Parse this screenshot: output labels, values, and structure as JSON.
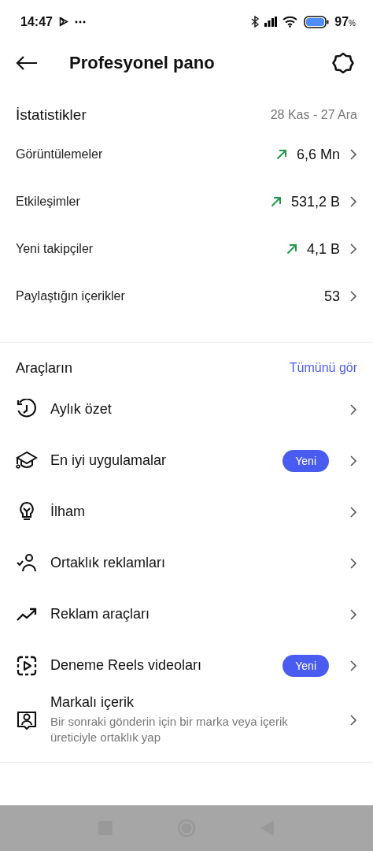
{
  "status_bar": {
    "time": "14:47",
    "battery_percent": "97",
    "percent_sign": "%"
  },
  "header": {
    "title": "Profesyonel pano"
  },
  "statistics": {
    "title": "İstatistikler",
    "date_range": "28 Kas - 27 Ara",
    "rows": [
      {
        "label": "Görüntülemeler",
        "value": "6,6 Mn",
        "trending_up": true
      },
      {
        "label": "Etkileşimler",
        "value": "531,2 B",
        "trending_up": true
      },
      {
        "label": "Yeni takipçiler",
        "value": "4,1 B",
        "trending_up": true
      },
      {
        "label": "Paylaştığın içerikler",
        "value": "53",
        "trending_up": false
      }
    ]
  },
  "tools": {
    "title": "Araçların",
    "see_all": "Tümünü gör",
    "items": [
      {
        "kind": "clock",
        "label": "Aylık özet"
      },
      {
        "kind": "cap",
        "label": "En iyi uygulamalar",
        "badge": "Yeni"
      },
      {
        "kind": "bulb",
        "label": "İlham"
      },
      {
        "kind": "partner",
        "label": "Ortaklık reklamları"
      },
      {
        "kind": "trend",
        "label": "Reklam araçları"
      },
      {
        "kind": "reels",
        "label": "Deneme Reels videoları",
        "badge": "Yeni"
      },
      {
        "kind": "card",
        "label": "Markalı içerik",
        "subtitle": "Bir sonraki gönderin için bir marka veya içerik üreticiyle ortaklık yap"
      }
    ]
  }
}
